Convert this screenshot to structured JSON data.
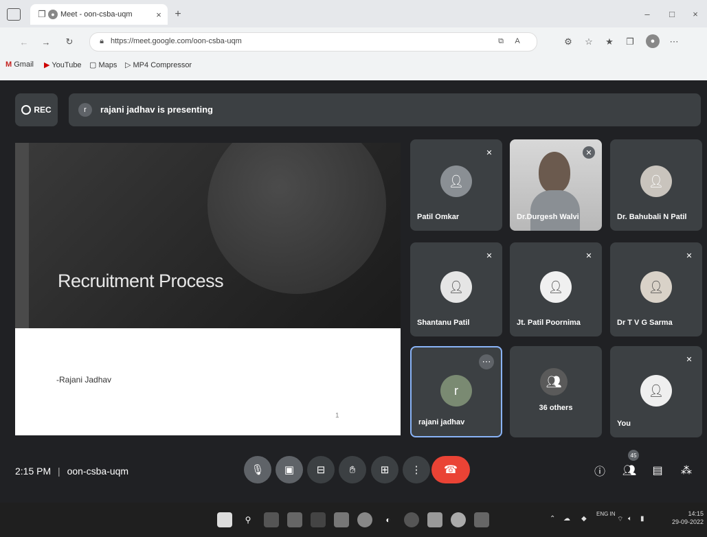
{
  "browser": {
    "tab_title": "Meet - oon-csba-uqm",
    "tab_close": "×",
    "new_tab": "+",
    "url": "https://meet.google.com/oon-csba-uqm",
    "window_controls": [
      "–",
      "□",
      "×"
    ],
    "bookmarks": [
      {
        "label": "Gmail",
        "icon": "gmail-icon"
      },
      {
        "label": "YouTube",
        "icon": "youtube-icon"
      },
      {
        "label": "Maps",
        "icon": "maps-icon"
      },
      {
        "label": "MP4 Compressor",
        "icon": "compressor-icon"
      }
    ]
  },
  "meet": {
    "rec_label": "REC",
    "presenting_banner": "rajani jadhav is presenting",
    "slide": {
      "title": "Recruitment Process",
      "author": "-Rajani Jadhav",
      "page_number": "1"
    },
    "participants": [
      {
        "name": "Patil Omkar",
        "muted": true,
        "avatar": "photo"
      },
      {
        "name": "Dr.Durgesh Walvi",
        "muted": true,
        "avatar": "video"
      },
      {
        "name": "Dr. Bahubali N Patil",
        "muted": false,
        "avatar": "photo"
      },
      {
        "name": "Shantanu Patil",
        "muted": true,
        "avatar": "photo"
      },
      {
        "name": "Jt. Patil Poornima",
        "muted": true,
        "avatar": "photo"
      },
      {
        "name": "Dr T V G Sarma",
        "muted": true,
        "avatar": "photo"
      },
      {
        "name": "rajani jadhav",
        "muted": false,
        "avatar": "letter",
        "letter": "r"
      },
      {
        "name": "36 others",
        "muted": false,
        "avatar": "group"
      },
      {
        "name": "You",
        "muted": true,
        "avatar": "photo"
      }
    ],
    "time": "2:15 PM",
    "separator": "|",
    "meeting_code": "oon-csba-uqm",
    "people_badge": "45"
  },
  "taskbar": {
    "time": "14:15",
    "date": "29-09-2022",
    "lang": "ENG IN"
  },
  "colors": {
    "meet_bg": "#202124",
    "tile_bg": "#3c4043",
    "hangup": "#ea4335"
  }
}
